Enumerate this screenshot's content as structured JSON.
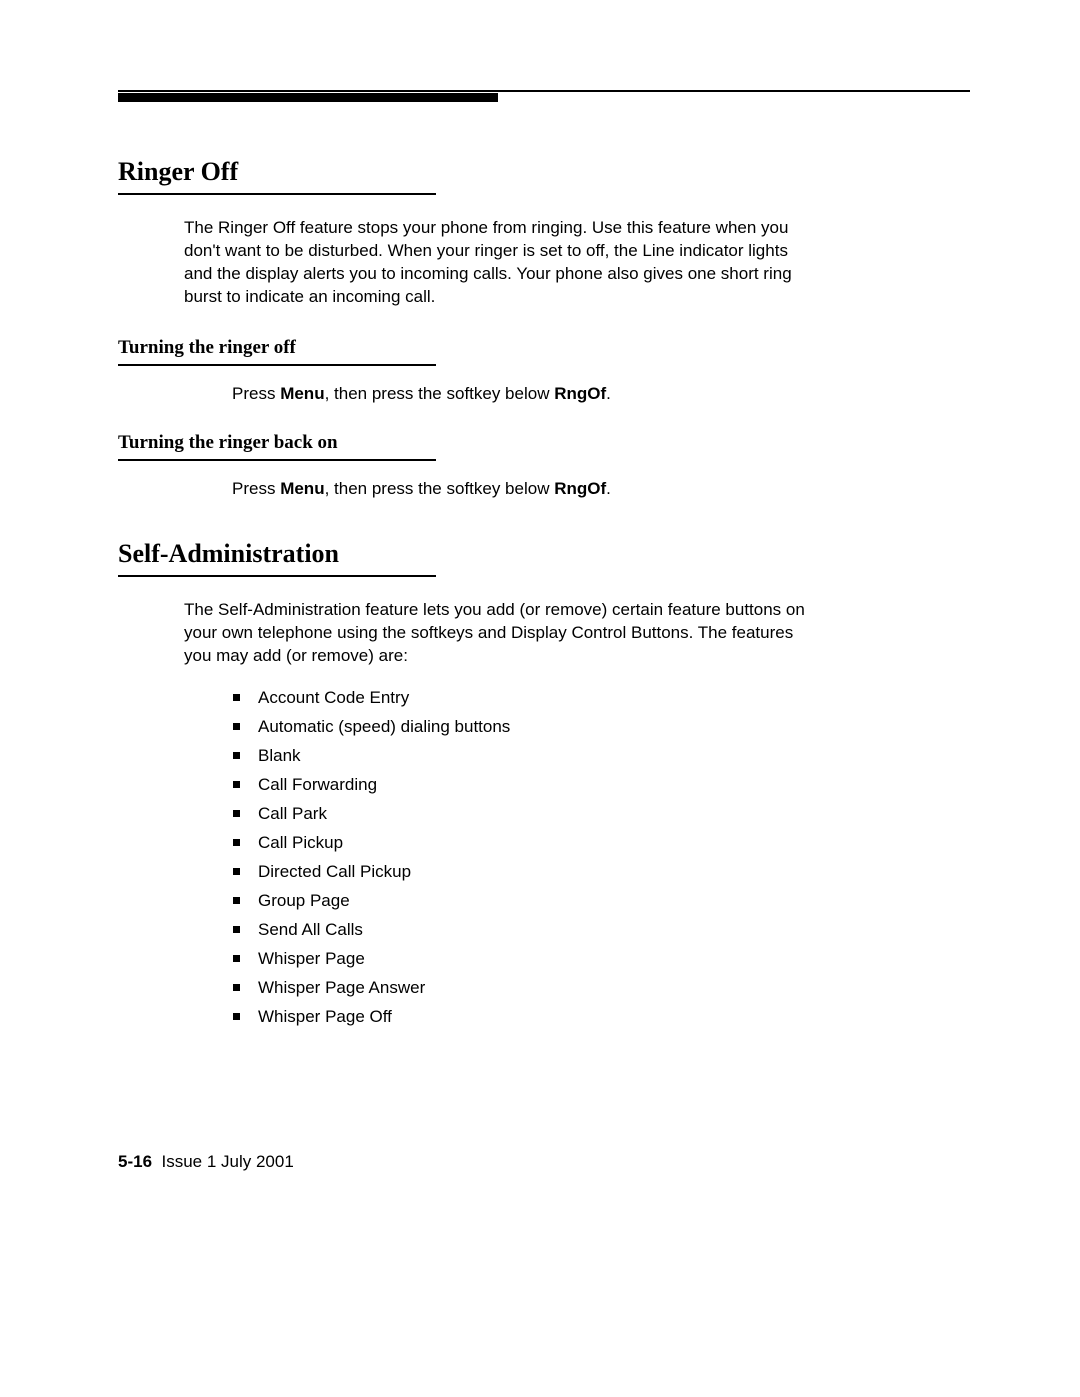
{
  "section1": {
    "heading": "Ringer Off",
    "para": "The Ringer Off feature stops your phone from ringing. Use this feature when you don't want to be disturbed. When your ringer is set to off, the Line indicator lights and the display alerts you to incoming calls. Your phone also gives one short ring burst to indicate an incoming call.",
    "sub1": {
      "heading": "Turning the ringer off",
      "press": "Press ",
      "menu": "Menu",
      "mid": ", then press the softkey below ",
      "rngof": "RngOf",
      "end": "."
    },
    "sub2": {
      "heading": "Turning the ringer back on",
      "press": "Press ",
      "menu": "Menu",
      "mid": ", then press the softkey below ",
      "rngof": "RngOf",
      "end": "."
    }
  },
  "section2": {
    "heading": "Self-Administration",
    "para": "The Self-Administration feature lets you add (or remove) certain feature buttons on your own telephone using the softkeys and Display Control Buttons. The features you may add (or remove) are:",
    "items": [
      "Account Code Entry",
      "Automatic (speed) dialing buttons",
      "Blank",
      "Call Forwarding",
      "Call Park",
      "Call Pickup",
      "Directed Call Pickup",
      "Group Page",
      "Send All Calls",
      "Whisper Page",
      "Whisper Page Answer",
      "Whisper Page Off"
    ]
  },
  "footer": {
    "page": "5-16",
    "issue": "Issue  1   July 2001"
  }
}
